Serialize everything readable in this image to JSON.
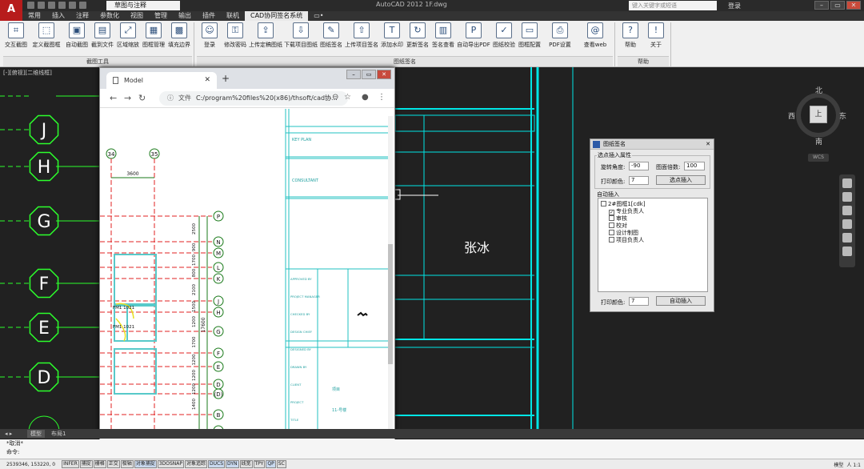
{
  "titlebar": {
    "logo": "A",
    "workspace": "草图与注释",
    "title": "AutoCAD 2012    1F.dwg",
    "search_placeholder": "键入关键字或短语",
    "user": "登录"
  },
  "menu": [
    "常用",
    "插入",
    "注释",
    "参数化",
    "视图",
    "管理",
    "输出",
    "插件",
    "联机",
    "CAD协同签名系统",
    "▭•"
  ],
  "menu_active": "CAD协同签名系统",
  "ribbon": {
    "groups": [
      {
        "label": "截图工具",
        "buttons": [
          "交互截图",
          "定义截图框",
          "自动截图",
          "截到文件",
          "区域缩放",
          "图框管理",
          "填充边界"
        ]
      },
      {
        "label": "图纸签名",
        "buttons": [
          "登录",
          "修改密码",
          "上传定稿图纸",
          "下载项目图纸",
          "图纸签名",
          "上传项目签名",
          "添加水印",
          "更新签名",
          "签名查看",
          "自动导出PDF",
          "图纸校验",
          "图框配置",
          "PDF设置",
          "查看web"
        ]
      },
      {
        "label": "帮助",
        "buttons": [
          "帮助",
          "关于"
        ]
      }
    ]
  },
  "viewport_label": "[-][俯视][二维线框]",
  "grid_bubbles": [
    "J",
    "H",
    "G",
    "F",
    "E",
    "D"
  ],
  "viewcube": {
    "north": "北",
    "south": "南",
    "east": "东",
    "west": "西",
    "top": "上",
    "wcs": "WCS"
  },
  "signature_text": "张冰",
  "browser": {
    "tab_title": "Model",
    "url_prefix": "文件",
    "url": "C:/program%20files%20(x86)/thsoft/cad协...",
    "drawing": {
      "col_labels": [
        "34",
        "35"
      ],
      "dim_top": "3600",
      "row_labels": [
        "P",
        "N",
        "M",
        "L",
        "K",
        "J",
        "H",
        "G",
        "F",
        "E",
        "D",
        "(D)",
        "B",
        "A"
      ],
      "dims": [
        "2500",
        "900",
        "1700",
        "800",
        "2100",
        "1500",
        "1200",
        "1700",
        "1200",
        "1200",
        "1200",
        "1400"
      ],
      "total_dim": "17600",
      "room_labels": [
        "FM1 1021",
        "FM1 1021"
      ],
      "tb_labels": [
        "APPROVED BY",
        "PROJECT MANAGER",
        "CHECKED BY",
        "DESIGN CHIEF",
        "DESIGNED BY",
        "DRAWN BY",
        "CLIENT",
        "PROJECT",
        "TITLE"
      ],
      "tb_header1": "KEY PLAN",
      "tb_header2": "CONSULTANT",
      "tb_values": [
        "项目",
        "11-号楼"
      ]
    }
  },
  "dialog": {
    "title": "图纸签名",
    "section1": "选点插入属性",
    "rotation_label": "旋转角度:",
    "rotation_value": "-90",
    "scale_label": "图面倍数:",
    "scale_value": "100",
    "color_label": "打印颜色:",
    "color_value": "7",
    "pick_button": "选点插入",
    "section2": "自动插入",
    "tree": [
      {
        "label": "2#图框1[cdk]",
        "checked": false,
        "level": 0
      },
      {
        "label": "专业负责人",
        "checked": true,
        "level": 1
      },
      {
        "label": "审核",
        "checked": false,
        "level": 1
      },
      {
        "label": "校对",
        "checked": false,
        "level": 1
      },
      {
        "label": "设计制图",
        "checked": false,
        "level": 1
      },
      {
        "label": "项目负责人",
        "checked": false,
        "level": 1
      }
    ],
    "color2_label": "打印颜色:",
    "color2_value": "7",
    "auto_button": "自动插入"
  },
  "layout_tabs": [
    "模型",
    "布局1"
  ],
  "command": {
    "history": "*取消*",
    "prompt": "命令:"
  },
  "status": {
    "coords": "2539346, 153220, 0",
    "toggles": [
      "INFER",
      "捕捉",
      "栅格",
      "正交",
      "极轴",
      "对象捕捉",
      "3DOSNAP",
      "对象追踪",
      "DUCS",
      "DYN",
      "线宽",
      "TPY",
      "QP",
      "SC"
    ],
    "model": "模型",
    "scale": "人 1:1"
  },
  "colors": {
    "cad_bg": "#212121",
    "cyan": "#00e5e5",
    "green": "#2cff2c",
    "red": "#ff3030"
  }
}
